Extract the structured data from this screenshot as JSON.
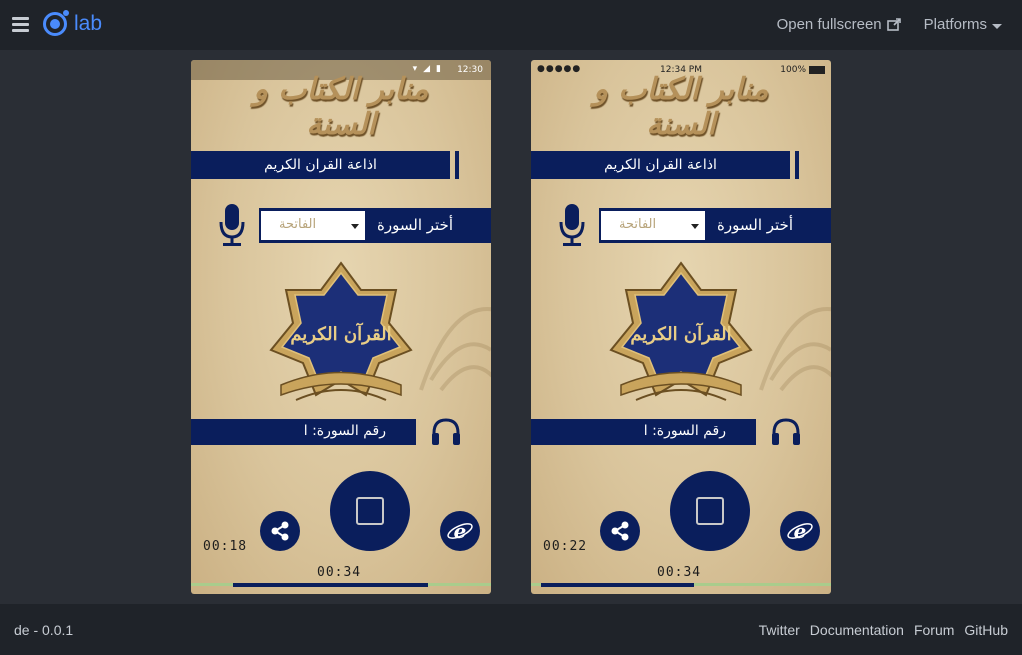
{
  "app": {
    "logo_text": "lab",
    "open_fullscreen": "Open fullscreen",
    "platforms": "Platforms",
    "version": "de - 0.0.1",
    "footer_links": [
      "Twitter",
      "Documentation",
      "Forum",
      "GitHub"
    ]
  },
  "colors": {
    "navy": "#0a1e5c",
    "parchment": "#d9c49b",
    "accent_blue": "#4a8bfc",
    "progress_track": "#a9cc8c"
  },
  "icons": [
    "menu-icon",
    "ionic-logo",
    "external-link-icon",
    "chevron-down-icon",
    "microphone-icon",
    "headphones-icon",
    "stop-icon",
    "share-icon",
    "browser-icon"
  ],
  "app_screen": {
    "header_calligraphy": "منابر الكتاب و السنة",
    "radio_title": "اذاعة القران الكريم",
    "select_label": "أختر السورة",
    "select_value": "الفاتحة",
    "emblem_text": "القرآن الكريم",
    "surah_number_label": "رقم السورة: ا",
    "total_time": "00:34"
  },
  "devices": {
    "android": {
      "status_time": "12:30",
      "current_time": "00:18",
      "progress": 0.65
    },
    "ios": {
      "status_time": "12:34 PM",
      "battery": "100%",
      "carrier": "●●●●● ",
      "current_time": "00:22",
      "progress": 0.51
    }
  }
}
